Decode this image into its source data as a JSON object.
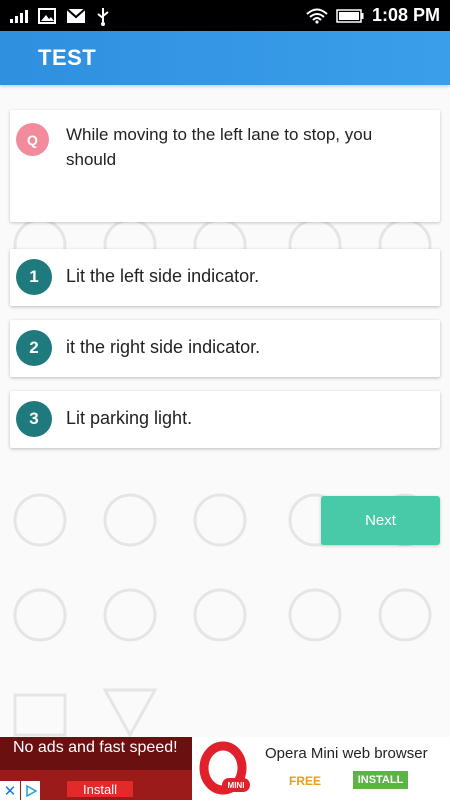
{
  "status_bar": {
    "time": "1:08 PM",
    "left_icons": [
      "signal-bars-icon",
      "image-icon",
      "gmail-icon",
      "usb-icon"
    ],
    "right_icons": [
      "wifi-icon",
      "battery-icon"
    ]
  },
  "app_bar": {
    "title": "TEST"
  },
  "question": {
    "badge": "Q",
    "text": "While moving to the left lane to stop, you should"
  },
  "options": [
    {
      "number": "1",
      "text": "Lit the left side indicator."
    },
    {
      "number": "2",
      "text": "it the right side indicator."
    },
    {
      "number": "3",
      "text": "Lit parking light."
    }
  ],
  "next_label": "Next",
  "colors": {
    "app_bar": "#2f8fe0",
    "question_badge": "#f28c9c",
    "option_badge": "#1f7a7d",
    "next_button": "#48c9a7"
  },
  "ad": {
    "tagline": "No ads and fast speed!",
    "install_label": "Install",
    "close_symbol": "✕",
    "app_name": "Opera Mini web browser",
    "price": "FREE",
    "install_button": "INSTALL",
    "logo_text": "MINI"
  }
}
